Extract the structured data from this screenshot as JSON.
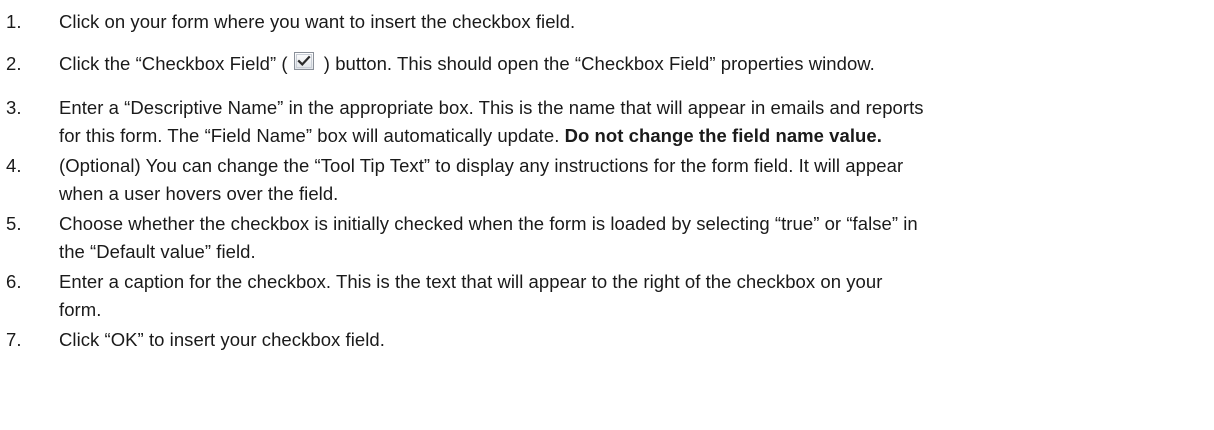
{
  "steps": [
    {
      "number": "1.",
      "lines": [
        "Click on your form where you want to insert the checkbox field."
      ]
    },
    {
      "number": "2.",
      "before_icon": "Click the “Checkbox Field” (",
      "icon": "checkbox-checked-icon",
      "after_icon": " ) button. This should open the “Checkbox Field” properties window."
    },
    {
      "number": "3.",
      "line1": "Enter a “Descriptive Name” in the appropriate box. This is the name that will appear in emails and reports",
      "line2_plain": "for this form. The “Field Name” box will automatically update. ",
      "line2_bold": "Do not change the field name value."
    },
    {
      "number": "4.",
      "lines": [
        "(Optional) You can change the “Tool Tip Text” to display any instructions for the form field. It will appear",
        "when a user hovers over the field."
      ]
    },
    {
      "number": "5.",
      "lines": [
        "Choose whether the checkbox is initially checked when the form is loaded by selecting “true” or “false” in",
        "the “Default value” field."
      ]
    },
    {
      "number": "6.",
      "lines": [
        "Enter a caption for the checkbox. This is the text that will appear to the right of the checkbox on your",
        "form."
      ]
    },
    {
      "number": "7.",
      "lines": [
        "Click “OK” to insert your checkbox field."
      ]
    }
  ]
}
